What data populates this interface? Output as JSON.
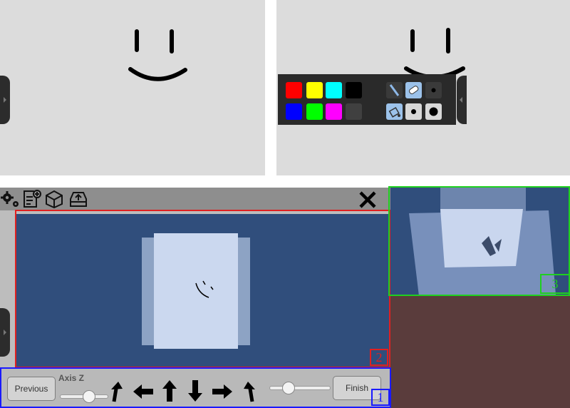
{
  "controls": {
    "previous_label": "Previous",
    "axis_label": "Axis Z",
    "finish_label": "Finish",
    "axis_slider_value": 0.55,
    "zoom_slider_value": 0.3
  },
  "annotations": {
    "box1": "1",
    "box2": "2",
    "box3": "3"
  },
  "palette": {
    "colors": [
      "#ff0000",
      "#ffff00",
      "#00ffff",
      "#000000",
      "#0000ff",
      "#00ff00",
      "#ff00ff",
      "#404040"
    ]
  },
  "colors": {
    "scene_background": "#304e7c",
    "annotation_red": "#e02020",
    "annotation_blue": "#1a1aff",
    "annotation_green": "#1fd01f",
    "floor": "#5a3c3c"
  }
}
